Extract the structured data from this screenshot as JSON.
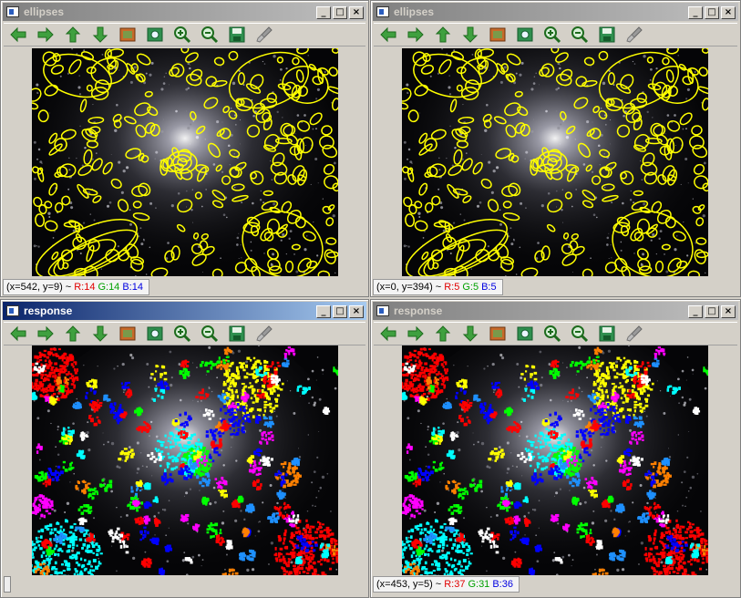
{
  "windows": [
    {
      "title": "ellipses",
      "status": {
        "coord": "(x=542, y=9)",
        "sep": "~",
        "r": "R:14",
        "g": "G:14",
        "b": "B:14"
      }
    },
    {
      "title": "ellipses",
      "status": {
        "coord": "(x=0, y=394)",
        "sep": "~",
        "r": "R:5",
        "g": "G:5",
        "b": "B:5"
      }
    },
    {
      "title": "response",
      "status": null
    },
    {
      "title": "response",
      "status": {
        "coord": "(x=453, y=5)",
        "sep": "~",
        "r": "R:37",
        "g": "G:31",
        "b": "B:36"
      }
    }
  ],
  "window_buttons": {
    "min": "_",
    "max": "□",
    "close": "×"
  },
  "toolbar_icons": [
    "arrow-left-icon",
    "arrow-right-icon",
    "arrow-up-icon",
    "arrow-down-icon",
    "image-icon",
    "zoom-fit-icon",
    "zoom-in-icon",
    "zoom-out-icon",
    "save-icon",
    "brush-icon"
  ],
  "colors": {
    "ellipse": "#ffff00",
    "response_blobs": [
      "#ff0000",
      "#ffff00",
      "#00ffff",
      "#0000ff",
      "#00ff00",
      "#ff00ff",
      "#ff8000",
      "#ffffff",
      "#1e90ff",
      "#ff0000"
    ]
  }
}
